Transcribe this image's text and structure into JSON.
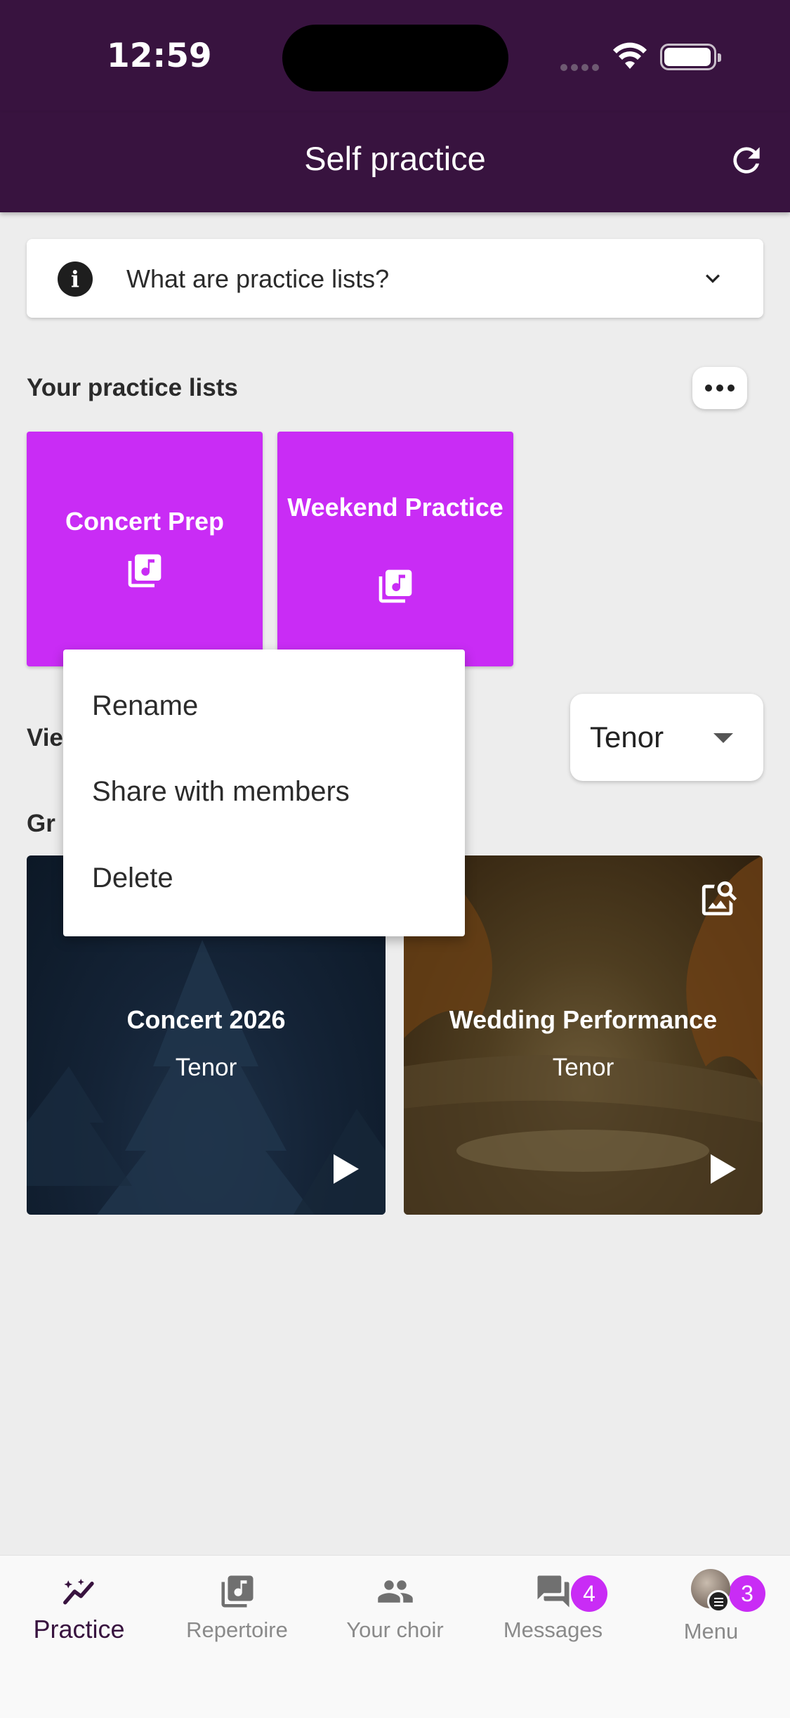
{
  "status_bar": {
    "time": "12:59"
  },
  "app_bar": {
    "title": "Self practice"
  },
  "info_card": {
    "text": "What are practice lists?"
  },
  "practice_lists": {
    "heading": "Your practice lists",
    "items": [
      {
        "title": "Concert Prep"
      },
      {
        "title": "Weekend Practice"
      }
    ]
  },
  "voice_section": {
    "heading_visible": "Vie",
    "selected_voice": "Tenor"
  },
  "groups_section": {
    "heading_visible": "Gr"
  },
  "group_cards": [
    {
      "title": "Concert 2026",
      "voice": "Tenor"
    },
    {
      "title": "Wedding Performance",
      "voice": "Tenor"
    }
  ],
  "context_menu": {
    "items": [
      {
        "label": "Rename"
      },
      {
        "label": "Share with members"
      },
      {
        "label": "Delete"
      }
    ]
  },
  "bottom_nav": {
    "items": [
      {
        "label": "Practice",
        "icon": "practice-trend-icon",
        "active": true
      },
      {
        "label": "Repertoire",
        "icon": "music-library-icon"
      },
      {
        "label": "Your choir",
        "icon": "people-icon"
      },
      {
        "label": "Messages",
        "icon": "chat-icon",
        "badge": "4"
      },
      {
        "label": "Menu",
        "icon": "avatar",
        "badge": "3"
      }
    ]
  },
  "colors": {
    "app_bar": "#38133f",
    "accent": "#c92cf5",
    "background": "#ededed"
  }
}
